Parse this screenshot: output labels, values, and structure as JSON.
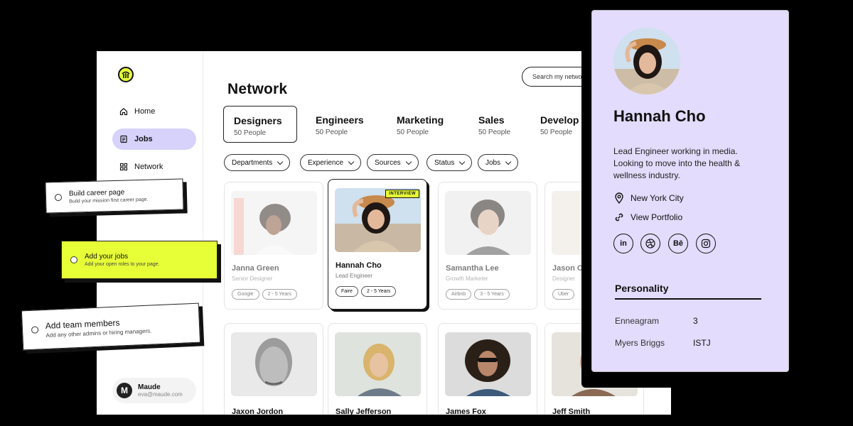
{
  "sidebar": {
    "items": [
      {
        "label": "Home"
      },
      {
        "label": "Jobs"
      },
      {
        "label": "Network"
      }
    ],
    "user": {
      "initial": "M",
      "name": "Maude",
      "email": "eva@maude.com"
    }
  },
  "main": {
    "title": "Network",
    "search_placeholder": "Search my network",
    "tabs": [
      {
        "label": "Designers",
        "count": "50 People"
      },
      {
        "label": "Engineers",
        "count": "50 People"
      },
      {
        "label": "Marketing",
        "count": "50 People"
      },
      {
        "label": "Sales",
        "count": "50 People"
      },
      {
        "label": "Develop",
        "count": "50 People"
      }
    ],
    "filters": [
      "Departments",
      "Experience",
      "Sources",
      "Status",
      "Jobs"
    ],
    "people_row1": [
      {
        "name": "Janna Green",
        "role": "Senior Designer",
        "tags": [
          "Google",
          "2 - 5 Years"
        ]
      },
      {
        "name": "Hannah Cho",
        "role": "Lead Engineer",
        "tags": [
          "Faire",
          "2 - 5 Years"
        ],
        "badge": "INTERVIEW"
      },
      {
        "name": "Samantha Lee",
        "role": "Growth Marketer",
        "tags": [
          "Airbnb",
          "3 - 5 Years"
        ]
      },
      {
        "name": "Jason C",
        "role": "Designer",
        "tags": [
          "Uber"
        ]
      }
    ],
    "people_row2": [
      {
        "name": "Jaxon Jordon"
      },
      {
        "name": "Sally Jefferson"
      },
      {
        "name": "James Fox"
      },
      {
        "name": "Jeff Smith"
      }
    ]
  },
  "tasks": [
    {
      "title": "Build career page",
      "subtitle": "Build your mission first career page."
    },
    {
      "title": "Add your jobs",
      "subtitle": "Add your open roles to your page."
    },
    {
      "title": "Add team members",
      "subtitle": "Add any other admins or hiring managers."
    }
  ],
  "profile": {
    "name": "Hannah Cho",
    "bio": "Lead Engineer working in media. Looking to move into the health & wellness industry.",
    "location": "New York City",
    "portfolio": "View Portfolio",
    "socials": [
      "in",
      "dribbble",
      "Bē",
      "instagram"
    ],
    "section_title": "Personality",
    "traits": [
      {
        "label": "Enneagram",
        "value": "3"
      },
      {
        "label": "Myers Briggs",
        "value": "ISTJ"
      }
    ]
  },
  "colors": {
    "accent_yellow": "#e7ff37",
    "accent_lavender": "#e3dcfc",
    "active_nav": "#d7d2fb"
  }
}
